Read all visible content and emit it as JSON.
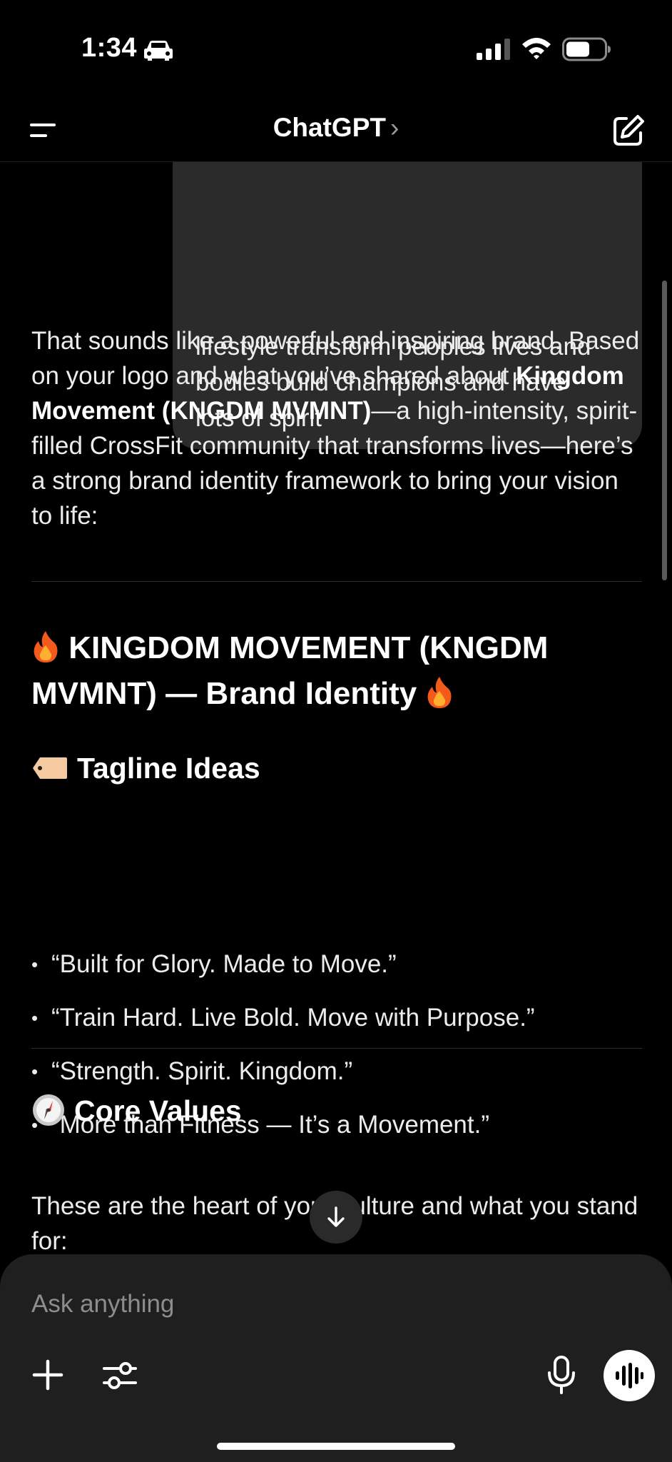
{
  "status_bar": {
    "time": "1:34",
    "icons": [
      "car-icon",
      "signal-icon",
      "wifi-icon",
      "battery-icon"
    ]
  },
  "nav": {
    "title": "ChatGPT",
    "chevron": "›",
    "left_icon": "menu-icon",
    "right_icon": "compose-icon"
  },
  "user_message": {
    "lines": [
      "lifestyle transform peoples lives and",
      "bodies build champions and have",
      "lots of spirit"
    ]
  },
  "assistant": {
    "intro_part1": "That sounds like a powerful and inspiring brand. Based on your logo and what you’ve shared about ",
    "intro_bold": "Kingdom Movement (KNGDM MVMNT)",
    "intro_part2": "—a high-intensity, spirit-filled CrossFit community that transforms lives—here’s a strong brand identity framework to bring your vision to life:",
    "brand_heading": "KINGDOM MOVEMENT (KNGDM MVMNT) — Brand Identity",
    "tagline_heading": "Tagline Ideas",
    "taglines": [
      "“Built for Glory. Made to Move.”",
      "“Train Hard. Live Bold. Move with Purpose.”",
      "“Strength. Spirit. Kingdom.”",
      "“More than Fitness — It’s a Movement.”"
    ],
    "core_values_heading": "Core Values",
    "core_values_intro": "These are the heart of your culture and what you stand for:"
  },
  "composer": {
    "placeholder": "Ask anything",
    "icons": [
      "plus-icon",
      "tools-icon",
      "mic-icon",
      "voice-mode-icon"
    ]
  },
  "colors": {
    "background": "#000000",
    "bubble": "#2b2b2b",
    "composer": "#1f1f1f",
    "text": "#ececec",
    "muted": "#8d8d8d"
  }
}
